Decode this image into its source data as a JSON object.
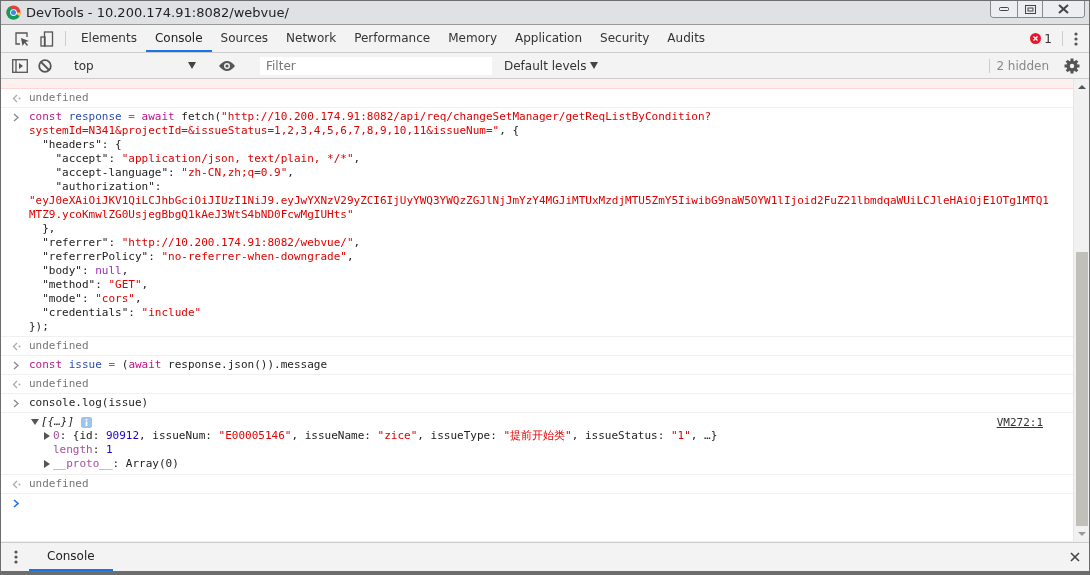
{
  "window": {
    "title": "DevTools - 10.200.174.91:8082/webvue/"
  },
  "tabs": [
    {
      "label": "Elements",
      "selected": false
    },
    {
      "label": "Console",
      "selected": true
    },
    {
      "label": "Sources",
      "selected": false
    },
    {
      "label": "Network",
      "selected": false
    },
    {
      "label": "Performance",
      "selected": false
    },
    {
      "label": "Memory",
      "selected": false
    },
    {
      "label": "Application",
      "selected": false
    },
    {
      "label": "Security",
      "selected": false
    },
    {
      "label": "Audits",
      "selected": false
    }
  ],
  "error_count": "1",
  "console_toolbar": {
    "context": "top",
    "filter": {
      "placeholder": "Filter"
    },
    "levels": "Default levels",
    "hidden": "2 hidden"
  },
  "entries": [
    {
      "kind": "error"
    },
    {
      "kind": "result",
      "text": "undefined"
    },
    {
      "kind": "input",
      "lines": [
        [
          {
            "kind": "keyword",
            "text": "const "
          },
          {
            "kind": "variable",
            "text": "response "
          },
          {
            "kind": "operator",
            "text": "= "
          },
          {
            "kind": "keyword",
            "text": "await"
          },
          {
            "kind": "plain",
            "text": " fetch("
          },
          {
            "kind": "string",
            "text": "\"http://10.200.174.91:8082/api/req/changeSetManager/getReqListByCondition?"
          }
        ],
        [
          {
            "kind": "string",
            "text": "systemId=N341&projectId=&issueStatus=1,2,3,4,5,6,7,8,9,10,11&issueNum=\""
          },
          {
            "kind": "plain",
            "text": ", {"
          }
        ],
        [
          {
            "kind": "plain",
            "text": "  \"headers\": {"
          }
        ],
        [
          {
            "kind": "plain",
            "text": "    \"accept\": "
          },
          {
            "kind": "string",
            "text": "\"application/json, text/plain, */*\""
          },
          {
            "kind": "plain",
            "text": ","
          }
        ],
        [
          {
            "kind": "plain",
            "text": "    \"accept-language\": "
          },
          {
            "kind": "string",
            "text": "\"zh-CN,zh;q=0.9\""
          },
          {
            "kind": "plain",
            "text": ","
          }
        ],
        [
          {
            "kind": "plain",
            "text": "    \"authorization\":"
          }
        ],
        [
          {
            "kind": "string",
            "text": "\"eyJ0eXAiOiJKV1QiLCJhbGciOiJIUzI1NiJ9.eyJwYXNzV29yZCI6IjUyYWQ3YWQzZGJlNjJmYzY4MGJiMTUxMzdjMTU5ZmY5IiwibG9naW5OYW1lIjoid2FuZ21lbmdqaWUiLCJleHAiOjE1OTg1MTQ1"
          }
        ],
        [
          {
            "kind": "string",
            "text": "MTZ9.ycoKmwlZG0UsjegBbgQ1kAeJ3WtS4bND0FcwMgIUHts\""
          }
        ],
        [
          {
            "kind": "plain",
            "text": "  },"
          }
        ],
        [
          {
            "kind": "plain",
            "text": "  \"referrer\": "
          },
          {
            "kind": "string",
            "text": "\"http://10.200.174.91:8082/webvue/\""
          },
          {
            "kind": "plain",
            "text": ","
          }
        ],
        [
          {
            "kind": "plain",
            "text": "  \"referrerPolicy\": "
          },
          {
            "kind": "string",
            "text": "\"no-referrer-when-downgrade\""
          },
          {
            "kind": "plain",
            "text": ","
          }
        ],
        [
          {
            "kind": "plain",
            "text": "  \"body\": "
          },
          {
            "kind": "null",
            "text": "null"
          },
          {
            "kind": "plain",
            "text": ","
          }
        ],
        [
          {
            "kind": "plain",
            "text": "  \"method\": "
          },
          {
            "kind": "string",
            "text": "\"GET\""
          },
          {
            "kind": "plain",
            "text": ","
          }
        ],
        [
          {
            "kind": "plain",
            "text": "  \"mode\": "
          },
          {
            "kind": "string",
            "text": "\"cors\""
          },
          {
            "kind": "plain",
            "text": ","
          }
        ],
        [
          {
            "kind": "plain",
            "text": "  \"credentials\": "
          },
          {
            "kind": "string",
            "text": "\"include\""
          }
        ],
        [
          {
            "kind": "plain",
            "text": "});"
          }
        ]
      ]
    },
    {
      "kind": "result",
      "text": "undefined"
    },
    {
      "kind": "input",
      "lines": [
        [
          {
            "kind": "keyword",
            "text": "const "
          },
          {
            "kind": "variable",
            "text": "issue "
          },
          {
            "kind": "operator",
            "text": "="
          },
          {
            "kind": "plain",
            "text": " ("
          },
          {
            "kind": "keyword",
            "text": "await"
          },
          {
            "kind": "plain",
            "text": " response.json()).message"
          }
        ]
      ]
    },
    {
      "kind": "result",
      "text": "undefined"
    },
    {
      "kind": "input",
      "lines": [
        [
          {
            "kind": "plain",
            "text": "console.log(issue)"
          }
        ]
      ]
    },
    {
      "kind": "log",
      "summary": "[{…}]",
      "expanded": true,
      "source": "VM272:1",
      "children": [
        {
          "expanded": false,
          "tokens": [
            {
              "kind": "property",
              "text": "0"
            },
            {
              "kind": "plain",
              "text": ": {id: "
            },
            {
              "kind": "number",
              "text": "90912"
            },
            {
              "kind": "plain",
              "text": ", issueNum: "
            },
            {
              "kind": "string",
              "text": "\"E00005146\""
            },
            {
              "kind": "plain",
              "text": ", issueName: "
            },
            {
              "kind": "string",
              "text": "\"zice\""
            },
            {
              "kind": "plain",
              "text": ", issueType: "
            },
            {
              "kind": "string",
              "text": "\"提前开始类\""
            },
            {
              "kind": "plain",
              "text": ", issueStatus: "
            },
            {
              "kind": "string",
              "text": "\"1\""
            },
            {
              "kind": "plain",
              "text": ", …}"
            }
          ]
        },
        {
          "tokens": [
            {
              "kind": "property",
              "text": "length"
            },
            {
              "kind": "plain",
              "text": ": "
            },
            {
              "kind": "number",
              "text": "1"
            }
          ]
        },
        {
          "expanded": false,
          "tokens": [
            {
              "kind": "property",
              "text": "__proto__"
            },
            {
              "kind": "plain",
              "text": ": Array(0)"
            }
          ]
        }
      ]
    },
    {
      "kind": "result",
      "text": "undefined"
    },
    {
      "kind": "prompt"
    }
  ],
  "drawer": {
    "tabs": [
      {
        "label": "Console",
        "selected": true
      }
    ]
  }
}
